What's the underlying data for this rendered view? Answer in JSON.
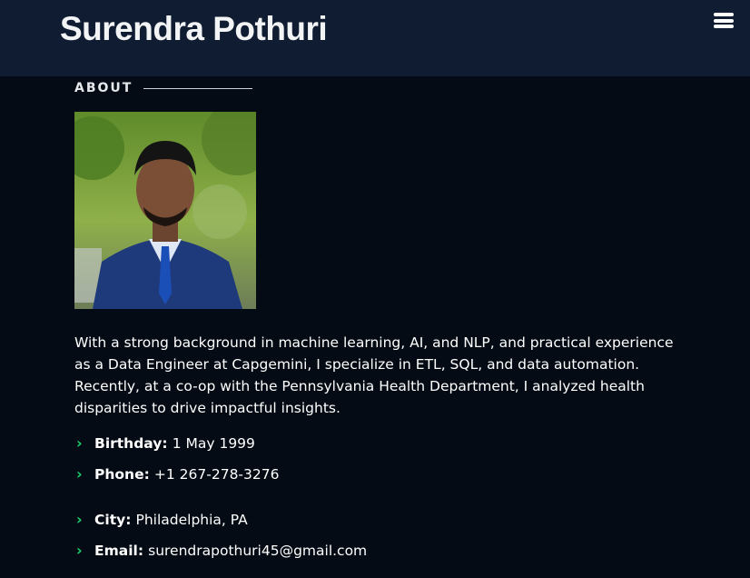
{
  "header": {
    "site_title": "Surendra Pothuri",
    "menu_icon": "bars-icon"
  },
  "about": {
    "section_label": "ABOUT",
    "bio": "With a strong background in machine learning, AI, and NLP, and practical experience as a Data Engineer at Capgemini, I specialize in ETL, SQL, and data automation. Recently, at a co-op with the Pennsylvania Health Department, I analyzed health disparities to drive impactful insights.",
    "details": [
      {
        "label": "Birthday:",
        "value": "1 May 1999"
      },
      {
        "label": "Phone:",
        "value": "+1 267-278-3276"
      },
      {
        "label": "City:",
        "value": "Philadelphia, PA"
      },
      {
        "label": "Email:",
        "value": "surendrapothuri45@gmail.com"
      }
    ]
  },
  "colors": {
    "background": "#040b14",
    "header_bg": "#0f1c31",
    "accent": "#18d26e"
  }
}
